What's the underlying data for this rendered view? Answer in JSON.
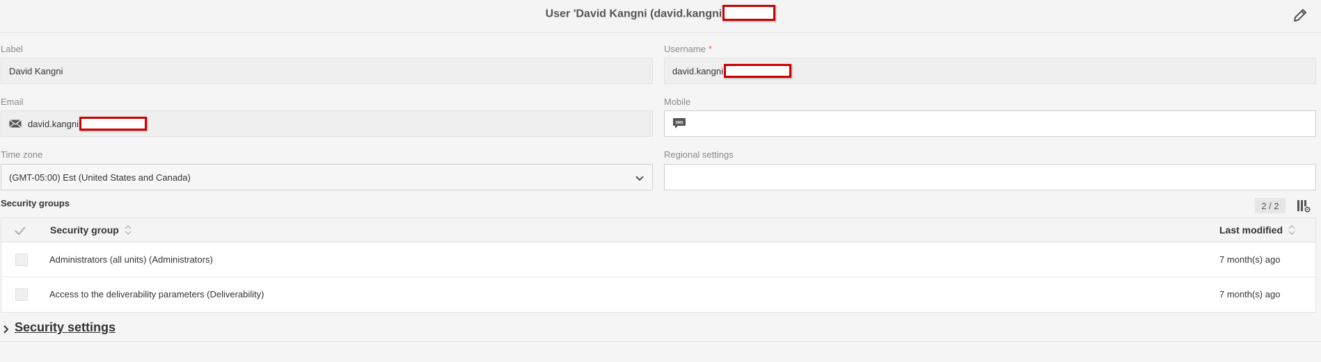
{
  "header": {
    "title": "User 'David Kangni (david.kangni"
  },
  "form": {
    "label": {
      "label": "Label",
      "value": "David Kangni"
    },
    "username": {
      "label": "Username",
      "required_mark": "*",
      "value": "david.kangni"
    },
    "email": {
      "label": "Email",
      "value": "david.kangni"
    },
    "mobile": {
      "label": "Mobile",
      "value": ""
    },
    "timezone": {
      "label": "Time zone",
      "value": "(GMT-05:00) Est (United States and Canada)"
    },
    "regional": {
      "label": "Regional settings",
      "value": ""
    }
  },
  "security_groups": {
    "title": "Security groups",
    "count": "2 / 2",
    "columns": {
      "group": "Security group",
      "modified": "Last modified"
    },
    "rows": [
      {
        "group": "Administrators (all units) (Administrators)",
        "modified": "7 month(s) ago"
      },
      {
        "group": "Access to the deliverability parameters (Deliverability)",
        "modified": "7 month(s) ago"
      }
    ]
  },
  "security_settings": {
    "title": "Security settings"
  },
  "icons": {
    "edit": "pencil-icon",
    "email": "envelope-icon",
    "mobile": "sms-icon",
    "dropdown": "chevron-down-icon",
    "columns": "column-settings-icon",
    "check": "checkmark-icon",
    "sort": "sort-icon",
    "expand": "chevron-right-icon"
  },
  "colors": {
    "redaction": "#cc0000",
    "required": "#e06a3a"
  }
}
